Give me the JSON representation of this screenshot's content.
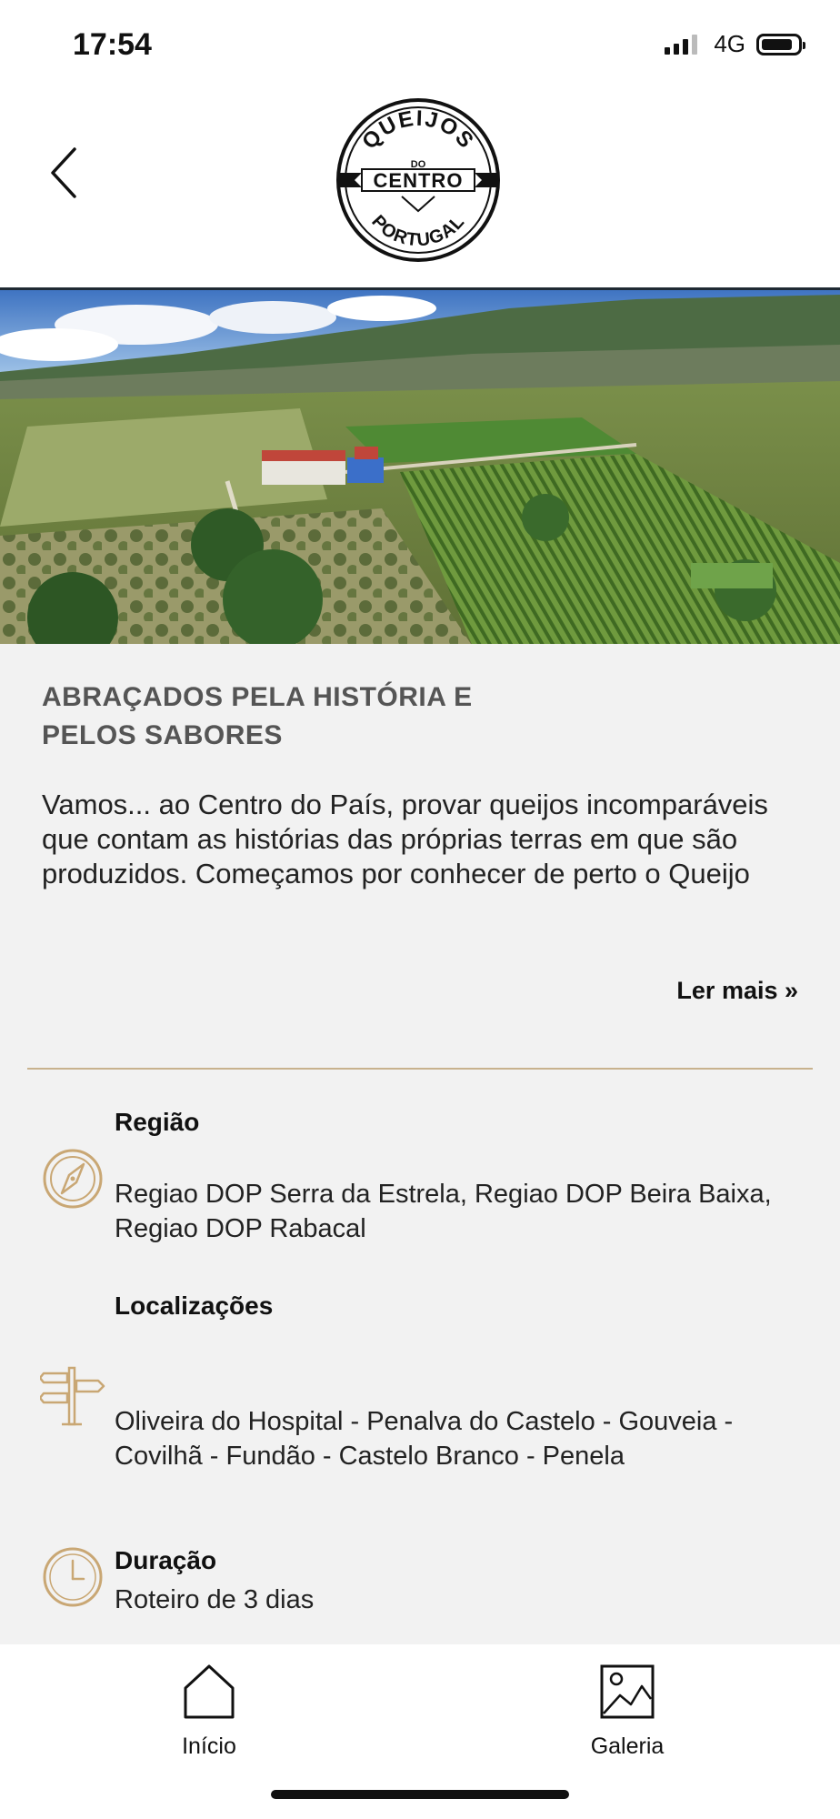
{
  "status_bar": {
    "time": "17:54",
    "network": "4G"
  },
  "header": {
    "logo_line1": "QUEIJOS",
    "logo_line2": "DO",
    "logo_line3": "CENTRO",
    "logo_line4": "PORTUGAL",
    "back_icon": "chevron-left-icon"
  },
  "hero": {
    "icon": "landscape-photo"
  },
  "article": {
    "headline_line1": "ABRAÇADOS PELA HISTÓRIA E",
    "headline_line2": "PELOS SABORES",
    "intro": "Vamos... ao Centro do País, provar queijos incomparáveis que contam as histórias das próprias terras em que são produzidos. Começamos por conhecer de perto o Queijo",
    "read_more": "Ler mais »"
  },
  "info": {
    "region": {
      "title": "Região",
      "text": "Regiao DOP Serra da Estrela, Regiao DOP Beira Baixa, Regiao DOP Rabacal",
      "icon": "compass-icon"
    },
    "locations": {
      "title": "Localizações",
      "text": "Oliveira do Hospital - Penalva do Castelo - Gouveia - Covilhã - Fundão - Castelo Branco - Penela",
      "icon": "signpost-icon"
    },
    "duration": {
      "title": "Duração",
      "text": "Roteiro de 3 dias",
      "icon": "clock-icon"
    }
  },
  "bottom_nav": {
    "home_label": "Início",
    "gallery_label": "Galeria"
  },
  "colors": {
    "accent_gold": "#c8b28e",
    "icon_gold": "#c9a774",
    "content_bg": "#f2f2f2"
  }
}
